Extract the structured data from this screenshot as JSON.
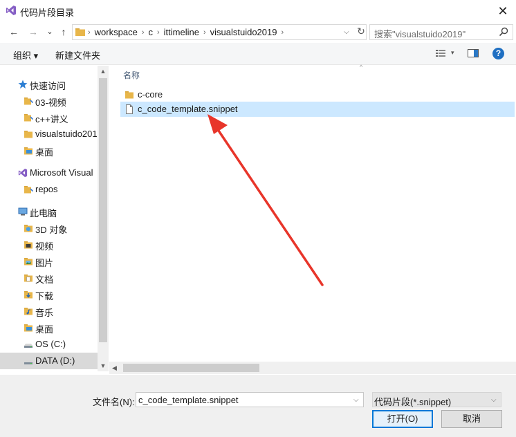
{
  "window": {
    "title": "代码片段目录",
    "close_glyph": "✕",
    "icon": "visual-studio-icon"
  },
  "nav": {
    "back_glyph": "←",
    "forward_glyph": "→",
    "history_glyph": "⌄",
    "up_glyph": "↑",
    "breadcrumbs": [
      "workspace",
      "c",
      "ittimeline",
      "visualstuido2019"
    ],
    "search_placeholder": "搜索\"visualstuido2019\"",
    "refresh_glyph": "↻"
  },
  "toolbar": {
    "organize": "组织 ▾",
    "new_folder": "新建文件夹",
    "help": "?"
  },
  "sidebar": {
    "items": [
      {
        "label": "快速访问",
        "icon": "star-icon",
        "level": 0,
        "selected": false
      },
      {
        "label": "03-视频",
        "icon": "pinned-folder-icon",
        "level": 1,
        "selected": false
      },
      {
        "label": "c++讲义",
        "icon": "pinned-folder-icon",
        "level": 1,
        "selected": false
      },
      {
        "label": "visualstuido201",
        "icon": "folder-icon",
        "level": 1,
        "selected": false
      },
      {
        "label": "桌面",
        "icon": "desktop-folder-icon",
        "level": 1,
        "selected": false
      },
      {
        "label": "Microsoft Visual",
        "icon": "visual-studio-icon",
        "level": 0,
        "selected": false
      },
      {
        "label": "repos",
        "icon": "pinned-folder-icon",
        "level": 1,
        "selected": false
      },
      {
        "label": "此电脑",
        "icon": "computer-icon",
        "level": 0,
        "selected": false
      },
      {
        "label": "3D 对象",
        "icon": "3d-objects-icon",
        "level": 1,
        "selected": false
      },
      {
        "label": "视频",
        "icon": "videos-icon",
        "level": 1,
        "selected": false
      },
      {
        "label": "图片",
        "icon": "pictures-icon",
        "level": 1,
        "selected": false
      },
      {
        "label": "文档",
        "icon": "documents-icon",
        "level": 1,
        "selected": false
      },
      {
        "label": "下载",
        "icon": "downloads-icon",
        "level": 1,
        "selected": false
      },
      {
        "label": "音乐",
        "icon": "music-icon",
        "level": 1,
        "selected": false
      },
      {
        "label": "桌面",
        "icon": "desktop-folder-icon",
        "level": 1,
        "selected": false
      },
      {
        "label": "OS (C:)",
        "icon": "drive-icon",
        "level": 1,
        "selected": false
      },
      {
        "label": "DATA (D:)",
        "icon": "drive-icon",
        "level": 1,
        "selected": true
      }
    ]
  },
  "filelist": {
    "column_name": "名称",
    "items": [
      {
        "label": "c-core",
        "icon": "folder-icon",
        "selected": false
      },
      {
        "label": "c_code_template.snippet",
        "icon": "file-icon",
        "selected": true
      }
    ]
  },
  "bottom": {
    "filename_label": "文件名(N):",
    "filename_value": "c_code_template.snippet",
    "filetype_value": "代码片段(*.snippet)",
    "open_button": "打开(O)",
    "cancel_button": "取消"
  },
  "colors": {
    "selection": "#cce8ff",
    "arrow": "#e8352a",
    "folder": "#e8b64a",
    "accent": "#0078d7"
  }
}
